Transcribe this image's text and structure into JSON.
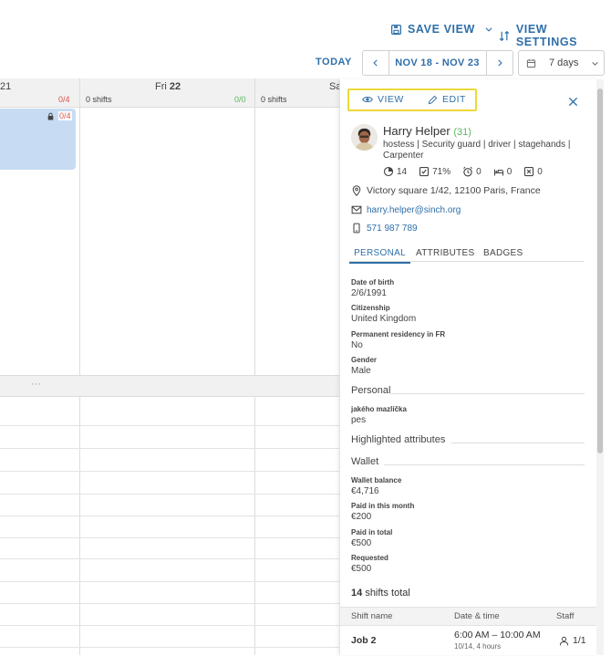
{
  "toolbar": {
    "save_view": "SAVE VIEW",
    "view_settings": "VIEW SETTINGS",
    "today": "TODAY",
    "date_range": "NOV 18 - NOV 23",
    "period": "7 days"
  },
  "calendar": {
    "partial_left_day": "21",
    "partial_left_ratio": "0/4",
    "block_ratio": "0/4",
    "fri_label": "Fri",
    "fri_num": "22",
    "fri_shifts": "0 shifts",
    "fri_ratio": "0/0",
    "sat_label": "Sa",
    "sat_shifts": "0 shifts",
    "ellipsis": "···"
  },
  "panel": {
    "view_label": "VIEW",
    "edit_label": "EDIT",
    "name": "Harry Helper",
    "age": "(31)",
    "roles_line1": "hostess | Security guard | driver | stagehands |",
    "roles_line2": "Carpenter",
    "stats": {
      "s1": "14",
      "s2": "71%",
      "s3": "0",
      "s4": "0",
      "s5": "0"
    },
    "address": "Victory square 1/42, 12100 Paris, France",
    "email": "harry.helper@sinch.org",
    "phone": "571 987 789",
    "tabs": {
      "personal": "PERSONAL",
      "attributes": "ATTRIBUTES",
      "badges": "BADGES"
    },
    "fields": {
      "dob_label": "Date of birth",
      "dob": "2/6/1991",
      "cit_label": "Citizenship",
      "cit": "United Kingdom",
      "perm_label": "Permanent residency in FR",
      "perm": "No",
      "gender_label": "Gender",
      "gender": "Male"
    },
    "personal_title": "Personal",
    "pet_label": "jakého mazlíčka",
    "pet": "pes",
    "highlighted_title": "Highlighted attributes",
    "wallet_title": "Wallet",
    "wallet": {
      "bal_label": "Wallet balance",
      "bal": "€4,716",
      "month_label": "Paid in this month",
      "month": "€200",
      "total_label": "Paid in total",
      "total": "€500",
      "req_label": "Requested",
      "req": "€500"
    },
    "shifts_count": "14",
    "shifts_total": "shifts total",
    "table": {
      "col_name": "Shift name",
      "col_date": "Date & time",
      "col_staff": "Staff",
      "row1_name": "Job 2",
      "row1_time": "6:00 AM – 10:00 AM",
      "row1_sub": "10/14, 4 hours",
      "row1_staff": "1/1"
    }
  }
}
